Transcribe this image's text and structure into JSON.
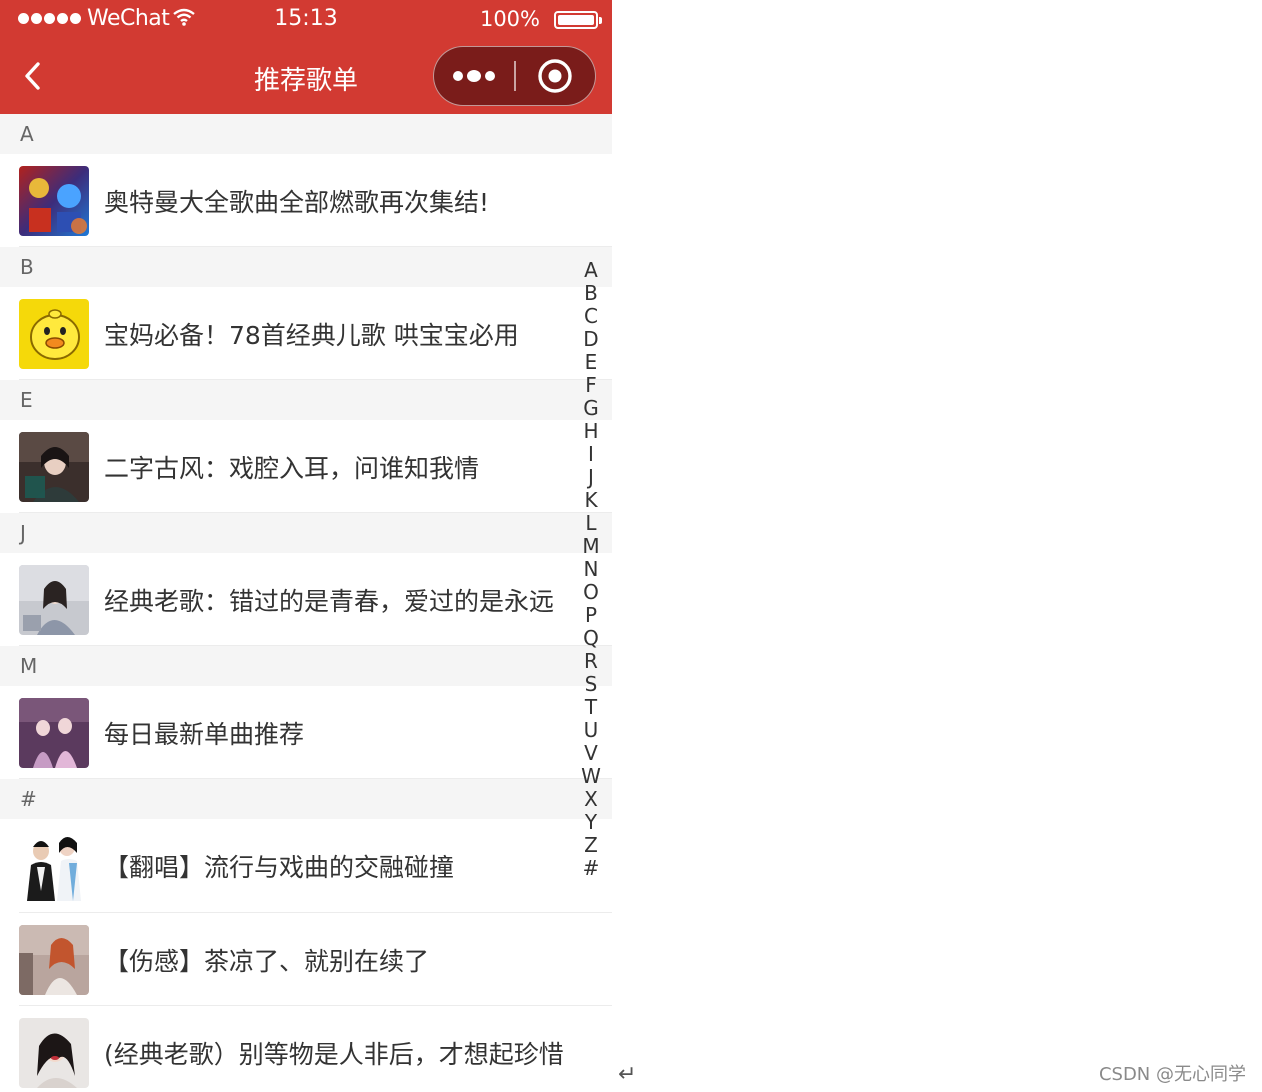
{
  "status_bar": {
    "carrier": "WeChat",
    "time": "15:13",
    "battery": "100%"
  },
  "nav": {
    "title": "推荐歌单"
  },
  "sections": [
    {
      "letter": "A",
      "items": [
        {
          "title": "奥特曼大全歌曲全部燃歌再次集结!",
          "cover": "ultraman-cover"
        }
      ]
    },
    {
      "letter": "B",
      "items": [
        {
          "title": "宝妈必备！78首经典儿歌 哄宝宝必用",
          "cover": "yellow-duck-cover"
        }
      ]
    },
    {
      "letter": "E",
      "items": [
        {
          "title": "二字古风：戏腔入耳，问谁知我情",
          "cover": "ancient-style-cover"
        }
      ]
    },
    {
      "letter": "J",
      "items": [
        {
          "title": "经典老歌：错过的是青春，爱过的是永远",
          "cover": "classic-girl-cover"
        }
      ]
    },
    {
      "letter": "M",
      "items": [
        {
          "title": "每日最新单曲推荐",
          "cover": "daily-single-cover"
        }
      ]
    },
    {
      "letter": "#",
      "items": [
        {
          "title": "【翻唱】流行与戏曲的交融碰撞",
          "cover": "cover-duet-cover"
        },
        {
          "title": "【伤感】茶凉了、就别在续了",
          "cover": "sad-girl-cover"
        },
        {
          "title": "(经典老歌）别等物是人非后，才想起珍惜",
          "cover": "classic-lady-cover"
        }
      ]
    }
  ],
  "index_letters": [
    "A",
    "B",
    "C",
    "D",
    "E",
    "F",
    "G",
    "H",
    "I",
    "J",
    "K",
    "L",
    "M",
    "N",
    "O",
    "P",
    "Q",
    "R",
    "S",
    "T",
    "U",
    "V",
    "W",
    "X",
    "Y",
    "Z",
    "#"
  ],
  "page_footer": {
    "return_glyph": "↵",
    "watermark": "CSDN @无心同学"
  },
  "colors": {
    "nav_bg": "#d23a32",
    "capsule_bg": "#7a1c1a",
    "section_bg": "#f5f5f5",
    "text": "#333333"
  }
}
